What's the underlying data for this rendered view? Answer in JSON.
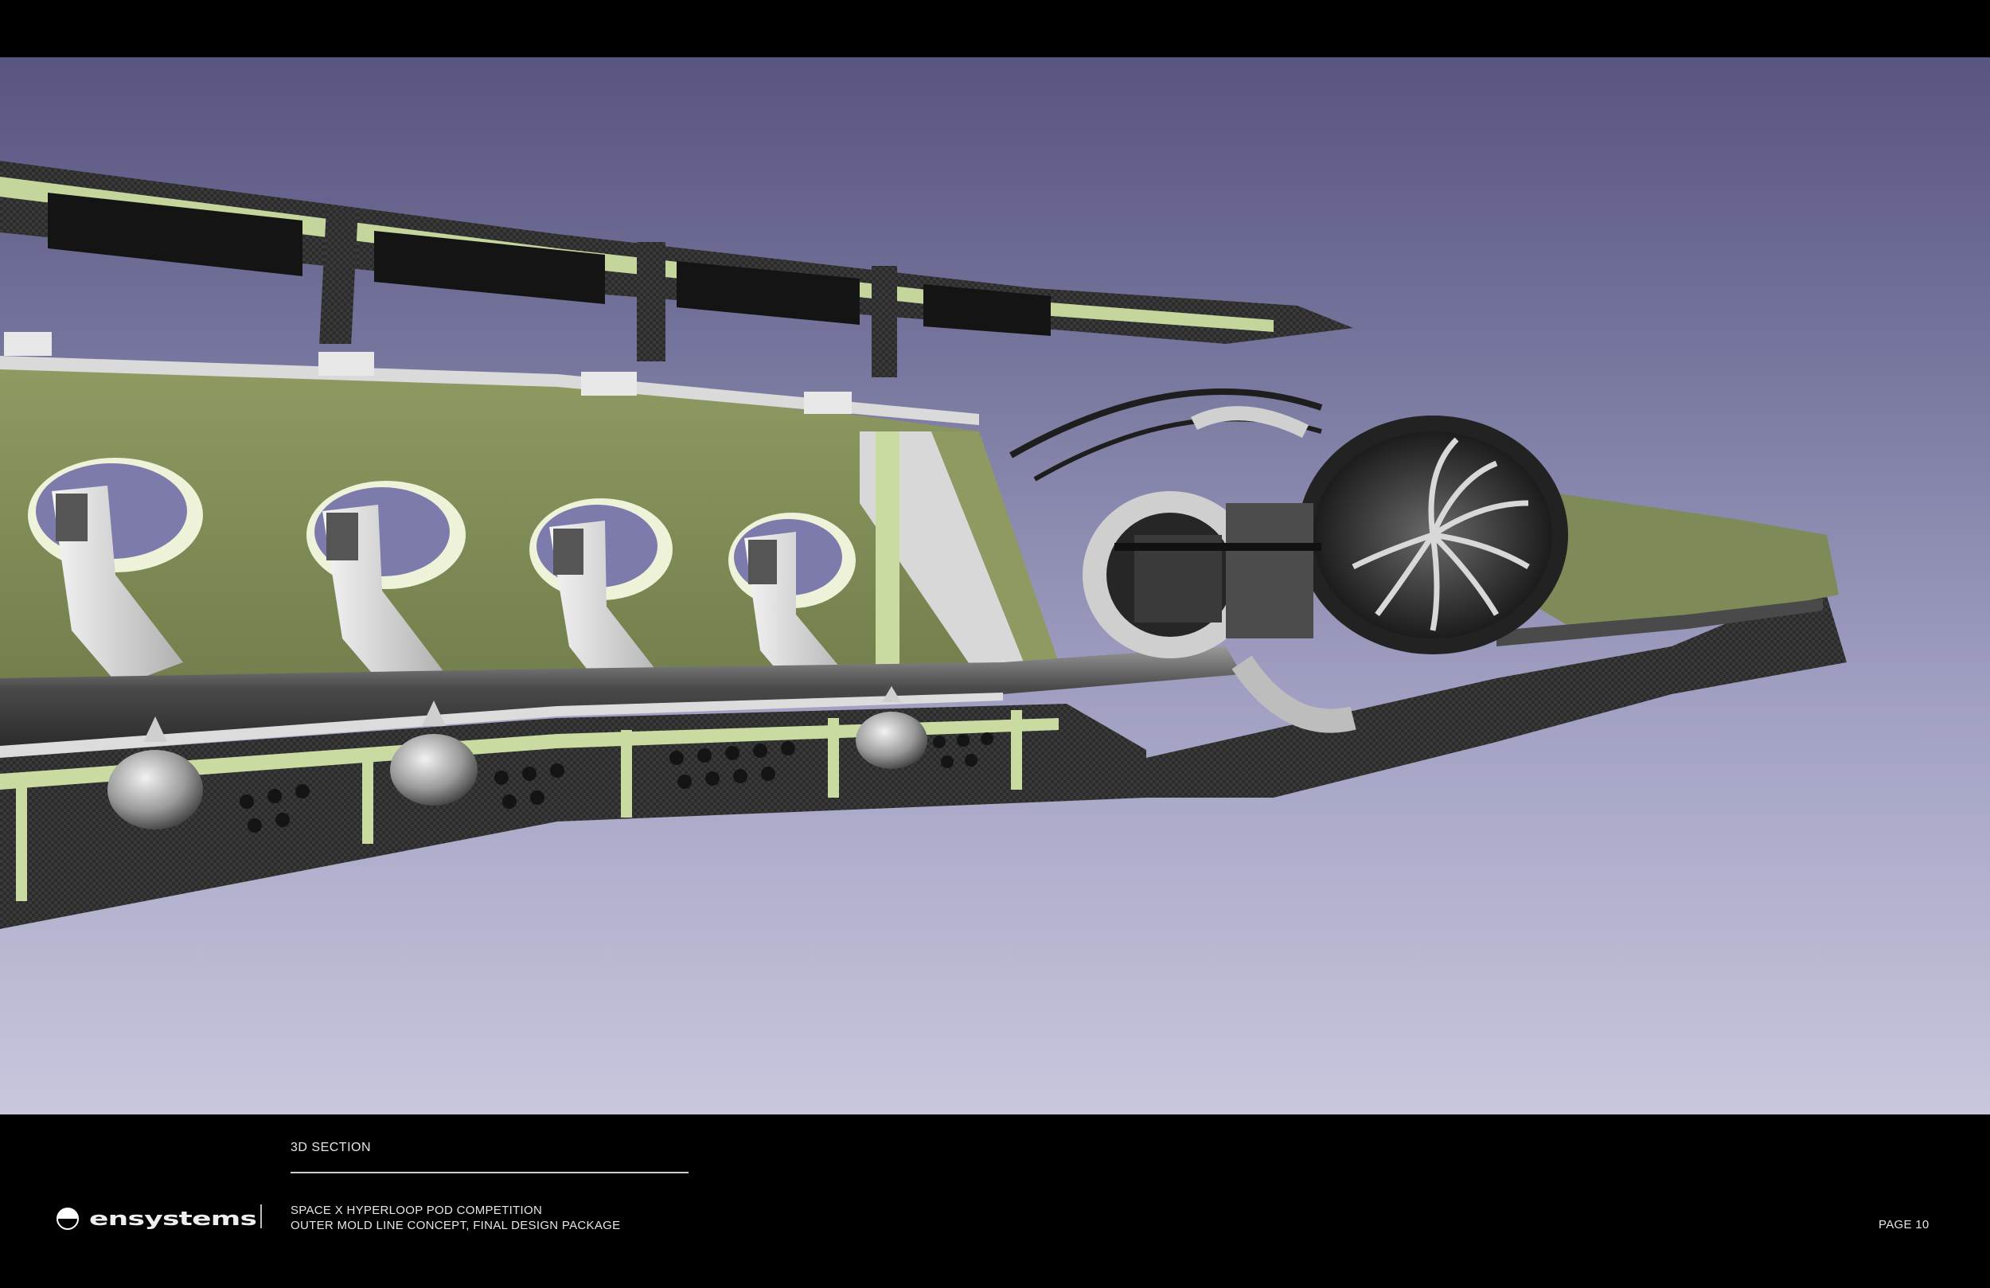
{
  "footer": {
    "section_label": "3D SECTION",
    "project_line1": "SPACE X HYPERLOOP POD COMPETITION",
    "project_line2": "OUTER MOLD LINE CONCEPT, FINAL DESIGN PACKAGE",
    "page_label": "PAGE 10"
  },
  "logo": {
    "text": "ensystems",
    "icon": "half-circle-logo-icon"
  },
  "colors": {
    "background_top": "#585580",
    "background_bottom": "#c8c7dd",
    "olive": "#7e8a58",
    "pale_green": "#c9dba0",
    "carbon": "#2a2a2a"
  }
}
